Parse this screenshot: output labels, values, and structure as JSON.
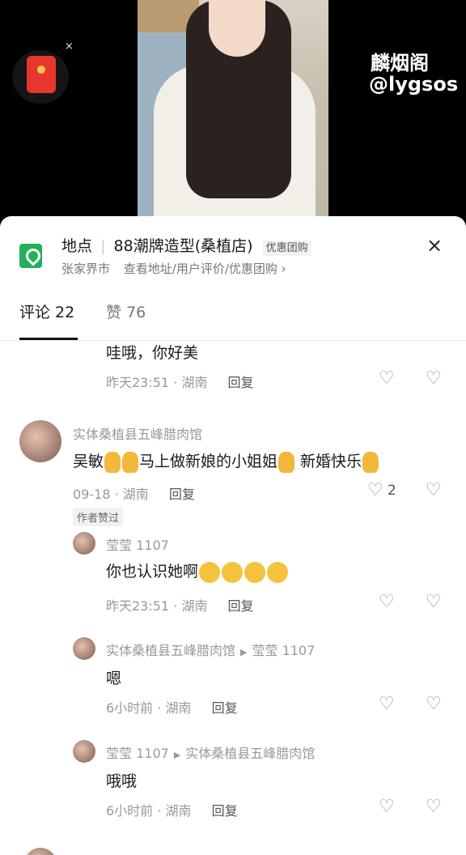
{
  "video": {
    "watermark_name": "麟烟阁",
    "watermark_handle": "@lygsos",
    "redpacket_close": "×"
  },
  "location": {
    "prefix": "地点",
    "name": "88潮牌造型(桑植店)",
    "tag": "优惠团购",
    "city": "张家界市",
    "links": "查看地址/用户评价/优惠团购 ›",
    "close": "×"
  },
  "tabs": {
    "comments": "评论 22",
    "likes": "赞 76"
  },
  "comments": [
    {
      "text": "哇哦，你好美",
      "time": "昨天23:51",
      "region": "湖南",
      "reply": "回复"
    },
    {
      "user": "实体桑植县五峰腊肉馆",
      "text_a": "吴敏",
      "text_b": "马上做新娘的小姐姐",
      "text_c": "新婚快乐",
      "time": "09-18",
      "region": "湖南",
      "reply": "回复",
      "likes": "2",
      "author_liked": "作者赞过"
    },
    {
      "user": "莹莹 1107",
      "text": "你也认识她啊",
      "time": "昨天23:51",
      "region": "湖南",
      "reply": "回复"
    },
    {
      "user": "实体桑植县五峰腊肉馆",
      "to": "莹莹 1107",
      "text": "嗯",
      "time": "6小时前",
      "region": "湖南",
      "reply": "回复"
    },
    {
      "user": "莹莹 1107",
      "to": "实体桑植县五峰腊肉馆",
      "text": "哦哦",
      "time": "6小时前",
      "region": "湖南",
      "reply": "回复"
    }
  ],
  "icons": {
    "heart": "♡",
    "dislike": "♡",
    "arrow": "▶",
    "dot": "·"
  }
}
